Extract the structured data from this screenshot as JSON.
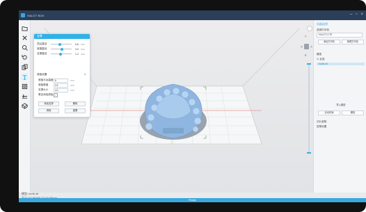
{
  "window": {
    "title": "HALOT BOX",
    "controls": [
      "–",
      "▫",
      "×"
    ]
  },
  "toolbar": {
    "icons": [
      "folder-icon",
      "move-icon",
      "zoom-icon",
      "rotate-icon",
      "copy-icon",
      "support-icon",
      "hollow-icon",
      "slice-icon",
      "settings-icon"
    ]
  },
  "panel": {
    "title": "支撑",
    "rows": [
      {
        "label": "顶尖直径",
        "value": "0.6",
        "unit": "mm",
        "level": 0.35
      },
      {
        "label": "底端直径",
        "value": "3.0",
        "unit": "mm",
        "level": 0.45
      },
      {
        "label": "支撑直径",
        "value": "1.2",
        "unit": "mm",
        "level": 0.4
      }
    ],
    "section_title": "底板设置",
    "fields": [
      {
        "label": "底板平台高度",
        "value": "6",
        "unit": "mm"
      },
      {
        "label": "底板厚度",
        "value": "0.5",
        "unit": "mm"
      },
      {
        "label": "支撑大小",
        "value": "4.0",
        "unit": "mm"
      },
      {
        "label": "是否添加底板",
        "value": "✓",
        "unit": ""
      }
    ],
    "buttons": [
      "添加支撑",
      "删除",
      "清除",
      "重置"
    ]
  },
  "right_panel": {
    "head": "机器选择",
    "printer_label": "选择打印机",
    "printer_value": "HALOT-LITE",
    "buttons": [
      "添加打印机",
      "管理打印机"
    ],
    "models_label": "模型",
    "all_label": "全选",
    "selected_model": "tooth.stl",
    "actions": [
      "导入模型",
      "自动布局",
      "删除"
    ],
    "slice_label": "切片参数",
    "slice_sub": "层厚设置"
  },
  "nav": {
    "left": "<",
    "right": ">",
    "top": "^",
    "bottom": "v"
  },
  "model_info": {
    "name": "模型: tooth.stl",
    "size": "大小: 67.56x68.71x19.45mm"
  },
  "status": {
    "text": "Ready"
  },
  "colors": {
    "accent": "#2fb2e8",
    "titlebar": "#2b3f58",
    "statusbar": "#3aa7df",
    "model": "#8fb6e0"
  }
}
